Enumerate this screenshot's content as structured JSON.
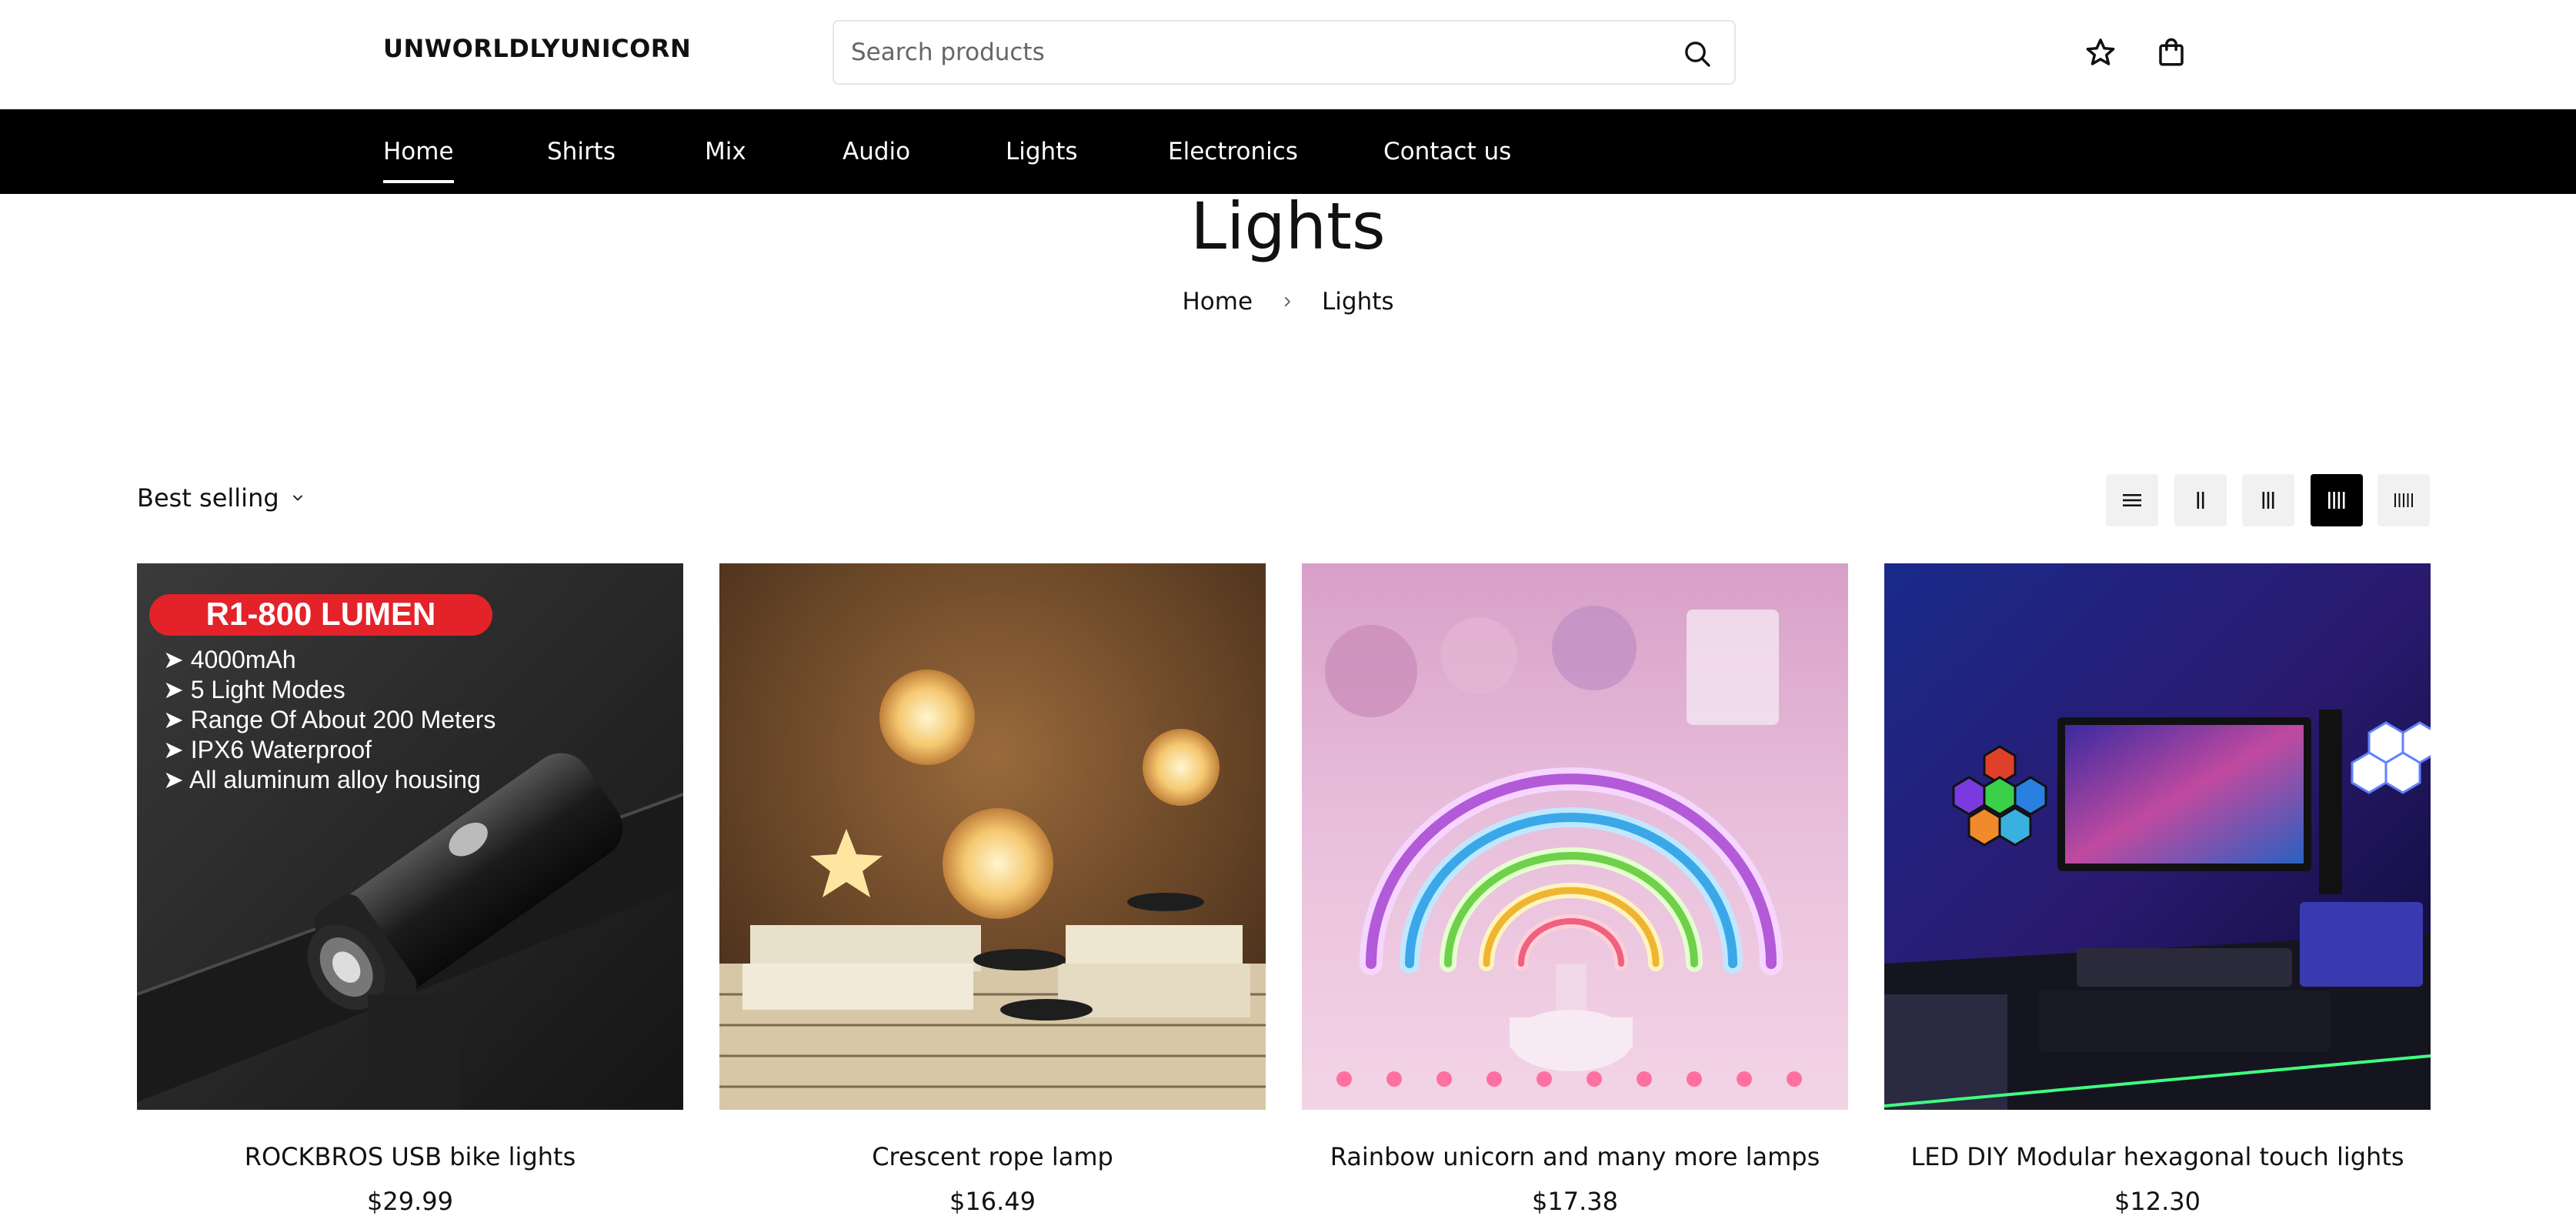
{
  "header": {
    "logo": "UNWORLDLYUNICORN",
    "search_placeholder": "Search products",
    "icons": [
      "search-icon",
      "star-icon",
      "shopping-bag-icon"
    ]
  },
  "nav": {
    "items": [
      {
        "label": "Home",
        "active": true
      },
      {
        "label": "Shirts"
      },
      {
        "label": "Mix"
      },
      {
        "label": "Audio"
      },
      {
        "label": "Lights"
      },
      {
        "label": "Electronics"
      },
      {
        "label": "Contact us"
      }
    ]
  },
  "page": {
    "title": "Lights",
    "breadcrumb": [
      "Home",
      "Lights"
    ]
  },
  "toolbar": {
    "sort_label": "Best selling",
    "grid_options": [
      "list-view-icon",
      "grid-2-icon",
      "grid-3-icon",
      "grid-4-icon",
      "grid-5-icon"
    ],
    "active_grid": "grid-4-icon"
  },
  "products": [
    {
      "name": "ROCKBROS USB bike lights",
      "price": "$29.99",
      "image_text": {
        "badge": "R1-800 LUMEN",
        "features": [
          "➤ 4000mAh",
          "➤ 5 Light Modes",
          "➤ Range Of About 200 Meters",
          "➤ IPX6 Waterproof",
          "➤ All aluminum alloy housing"
        ]
      }
    },
    {
      "name": "Crescent rope lamp",
      "price": "$16.49"
    },
    {
      "name": "Rainbow unicorn and many more lamps",
      "price": "$17.38"
    },
    {
      "name": "LED DIY Modular hexagonal touch lights",
      "price": "$12.30"
    }
  ],
  "colors": {
    "nav_bg": "#000000",
    "text": "#111111",
    "switch_bg": "#f1f1f1",
    "switch_active": "#000000"
  }
}
